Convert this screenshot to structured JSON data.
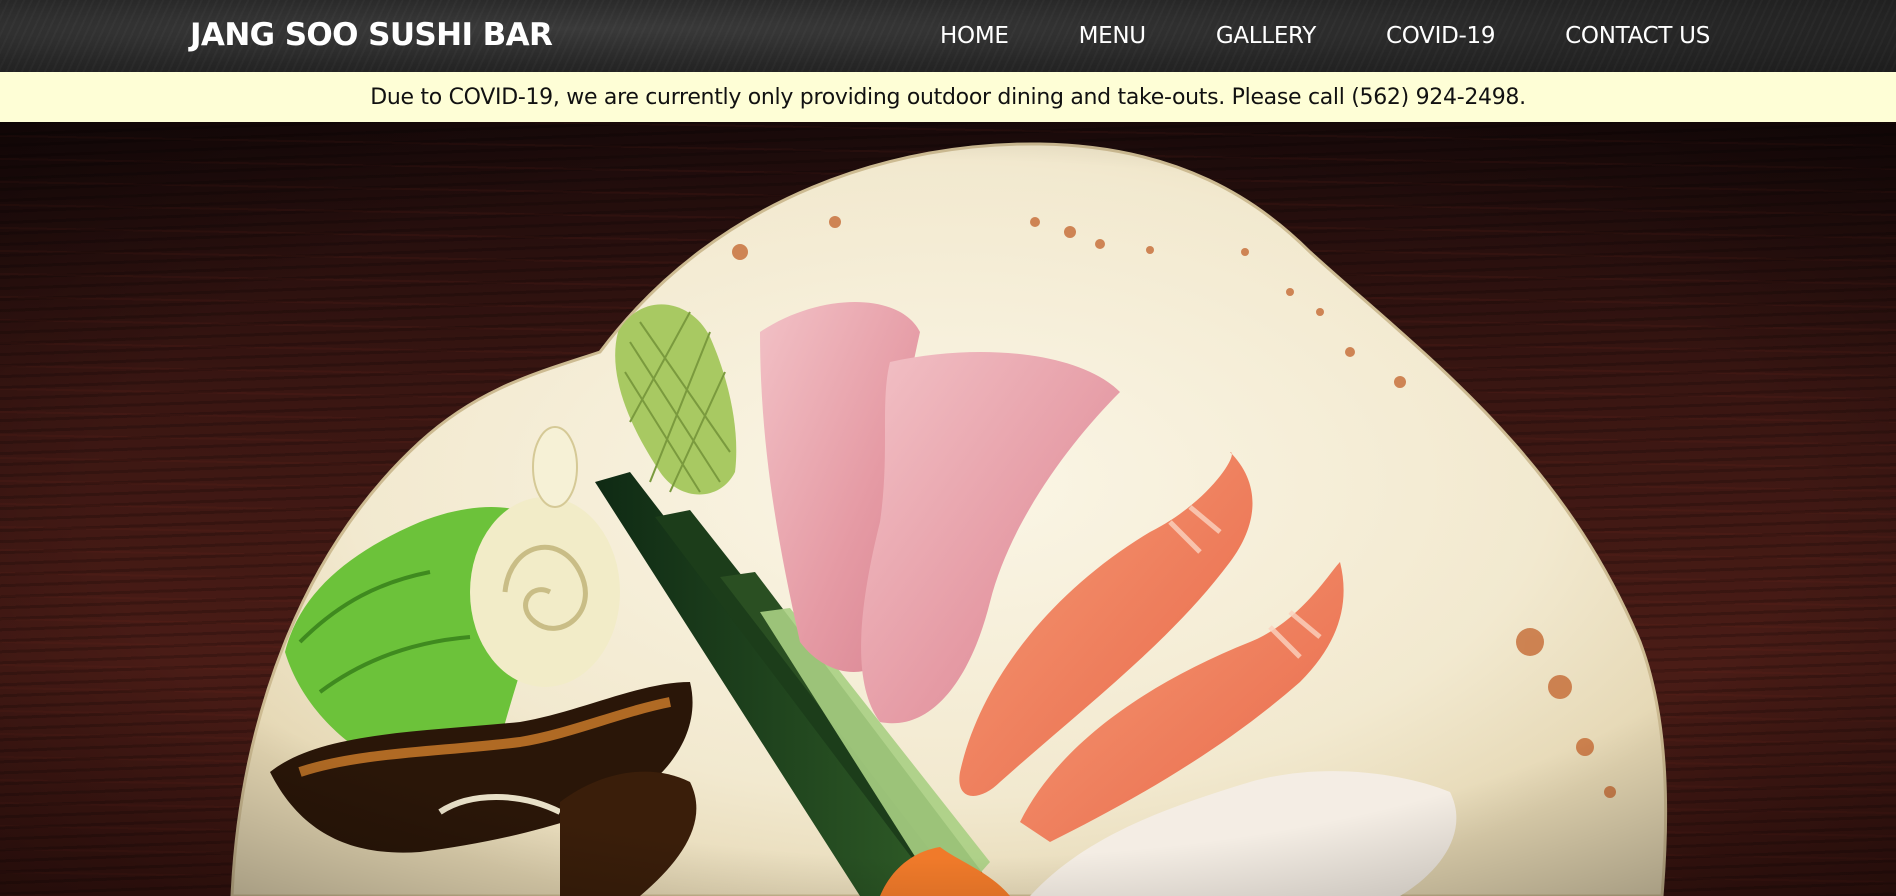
{
  "header": {
    "brand": "JANG SOO SUSHI BAR",
    "nav": [
      {
        "label": "HOME"
      },
      {
        "label": "MENU"
      },
      {
        "label": "GALLERY"
      },
      {
        "label": "COVID-19"
      },
      {
        "label": "CONTACT US"
      }
    ]
  },
  "notice": {
    "text": "Due to COVID-19, we are currently only providing outdoor dining and take-outs. Please call (562) 924-2498."
  },
  "colors": {
    "navbar": "#262626",
    "notice_bg": "#fefed6",
    "wood": "#3a1612",
    "plate": "#f3ecd6"
  }
}
